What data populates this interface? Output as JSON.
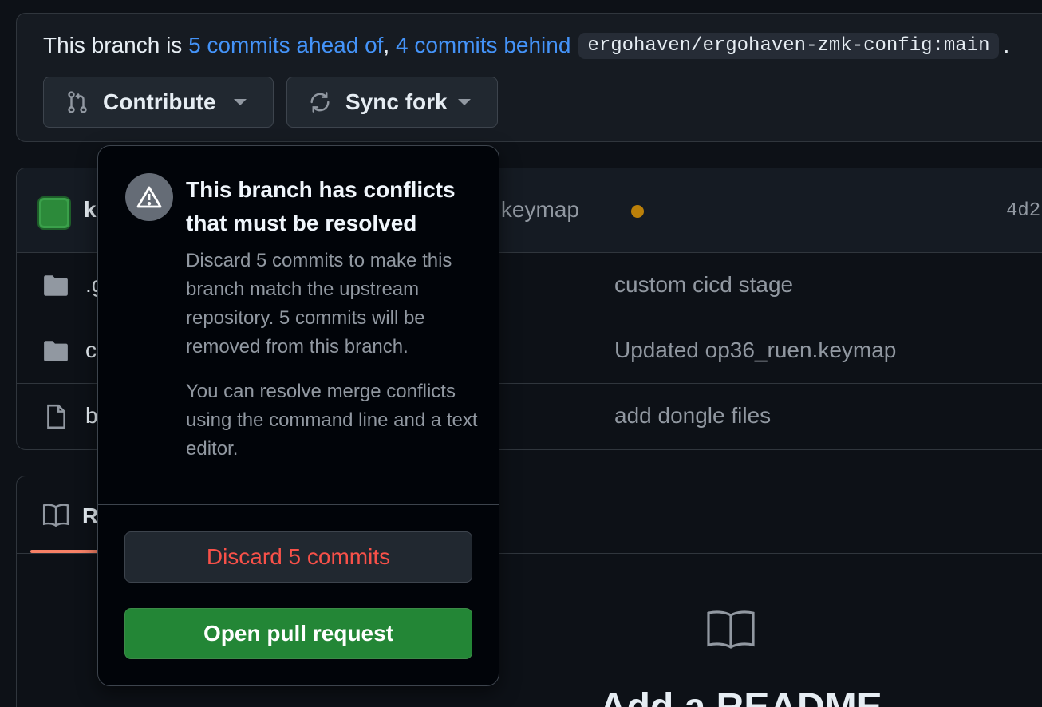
{
  "branch_status": {
    "prefix": "This branch is ",
    "ahead_link": "5 commits ahead of",
    "comma": ",",
    "behind_link": "4 commits behind",
    "upstream": "ergohaven/ergohaven-zmk-config:main",
    "period": "."
  },
  "actions": {
    "contribute_label": "Contribute",
    "sync_fork_label": "Sync fork"
  },
  "latest_commit": {
    "author_partial": "ke",
    "message_partial": "en.keymap",
    "sha_partial": "4d2"
  },
  "files": [
    {
      "name_partial": ".g",
      "type": "folder",
      "commit_message": "custom cicd stage"
    },
    {
      "name_partial": "c",
      "type": "folder",
      "commit_message": "Updated op36_ruen.keymap"
    },
    {
      "name_partial": "b",
      "type": "file",
      "commit_message": "add dongle files"
    }
  ],
  "readme": {
    "tab_partial": "R",
    "title_partial": "Add a README"
  },
  "popover": {
    "title": "This branch has conflicts that must be resolved",
    "description": "Discard 5 commits to make this branch match the upstream repository. 5 commits will be removed from this branch.",
    "hint": "You can resolve merge conflicts using the command line and a text editor.",
    "discard_label": "Discard 5 commits",
    "open_pr_label": "Open pull request"
  },
  "colors": {
    "link": "#4493f8",
    "danger": "#f85149",
    "success_bg": "#238636",
    "status_pending": "#bb8009"
  }
}
